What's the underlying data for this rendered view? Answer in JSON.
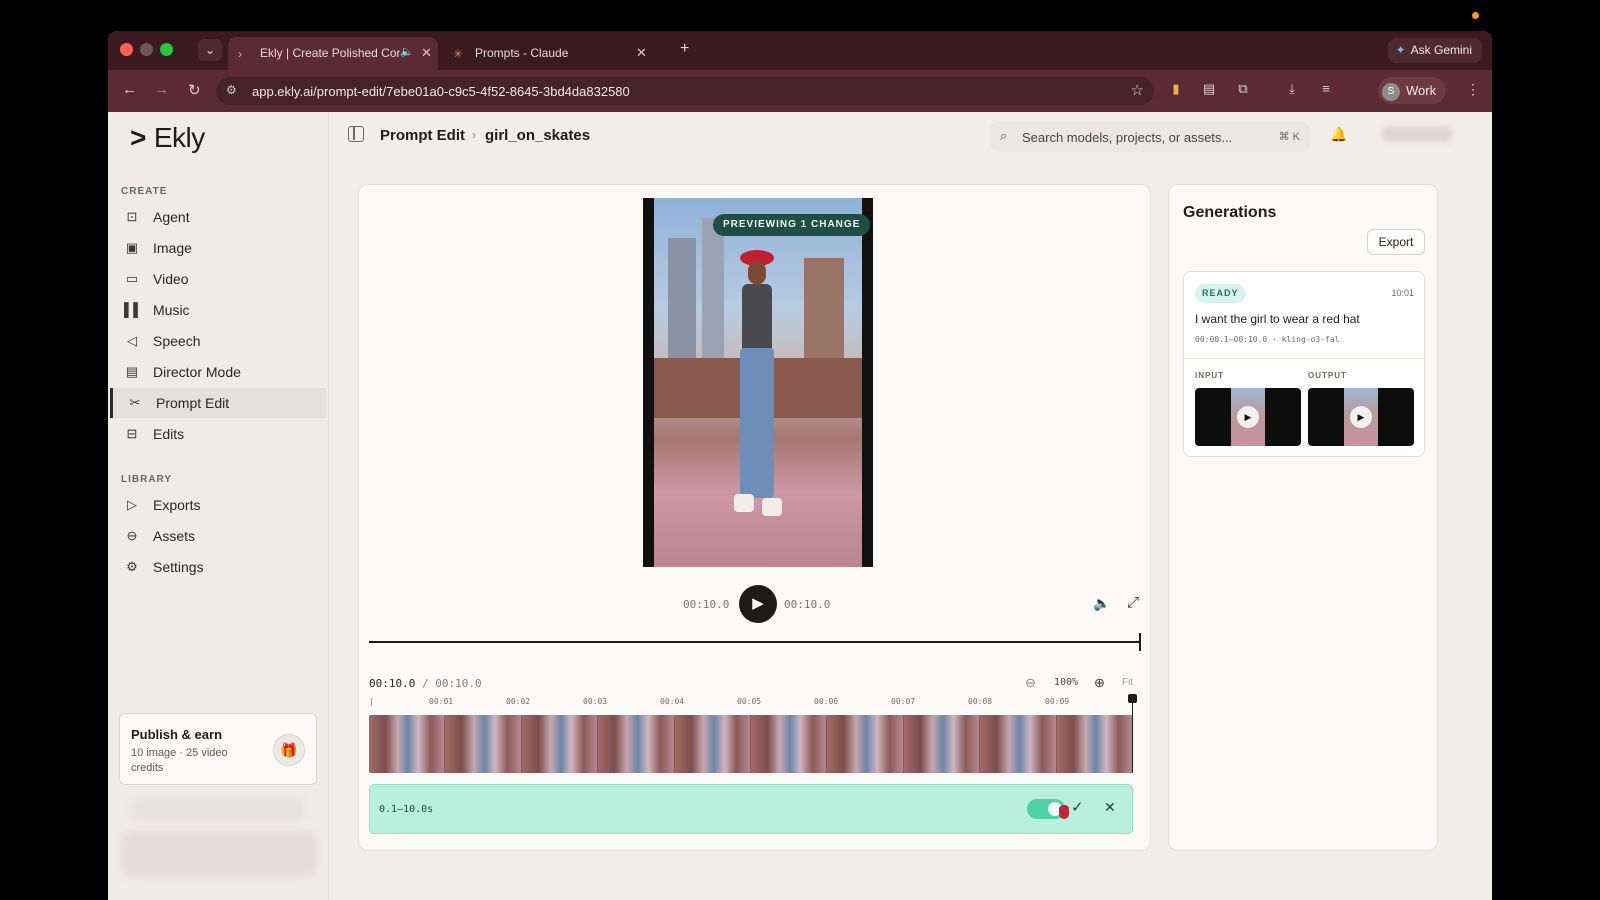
{
  "browser": {
    "tabs": [
      {
        "title": "Ekly | Create Polished Con",
        "active": true
      },
      {
        "title": "Prompts - Claude",
        "active": false
      }
    ],
    "url": "app.ekly.ai/prompt-edit/7ebe01a0-c9c5-4f52-8645-3bd4da832580",
    "ask_gemini": "Ask Gemini",
    "profile": {
      "initial": "S",
      "name": "Work"
    }
  },
  "app": {
    "logo": "Ekly",
    "sidebar": {
      "create_label": "CREATE",
      "create_items": [
        {
          "label": "Agent",
          "icon": "robot-icon"
        },
        {
          "label": "Image",
          "icon": "image-icon"
        },
        {
          "label": "Video",
          "icon": "video-icon"
        },
        {
          "label": "Music",
          "icon": "music-icon"
        },
        {
          "label": "Speech",
          "icon": "speech-icon"
        },
        {
          "label": "Director Mode",
          "icon": "clapper-icon"
        },
        {
          "label": "Prompt Edit",
          "icon": "scissors-icon",
          "active": true
        },
        {
          "label": "Edits",
          "icon": "edits-icon"
        }
      ],
      "library_label": "LIBRARY",
      "library_items": [
        {
          "label": "Exports",
          "icon": "play-outline-icon"
        },
        {
          "label": "Assets",
          "icon": "archive-icon"
        },
        {
          "label": "Settings",
          "icon": "gear-icon"
        }
      ],
      "publish": {
        "title": "Publish & earn",
        "subtitle": "10 image · 25 video credits"
      }
    },
    "header": {
      "breadcrumb": [
        "Prompt Edit",
        "girl_on_skates"
      ],
      "search_placeholder": "Search models, projects, or assets...",
      "search_shortcut": "⌘ K"
    },
    "editor": {
      "preview_badge": "PREVIEWING 1 CHANGE",
      "time_current": "00:10.0",
      "time_end": "00:10.0",
      "timeline_time": "00:10.0",
      "timeline_total": "/ 00:10.0",
      "zoom": "100%",
      "fit_label": "Fit",
      "ruler_ticks": [
        "00:01",
        "00:02",
        "00:03",
        "00:04",
        "00:05",
        "00:06",
        "00:07",
        "00:08",
        "00:09"
      ],
      "clip_range": "0.1–10.0s",
      "clip_enabled": true,
      "playback_progress": 1.0
    },
    "generations": {
      "title": "Generations",
      "export_label": "Export",
      "items": [
        {
          "status": "READY",
          "time": "10:01",
          "prompt": "I want the girl to wear a red hat",
          "meta": "00:00.1–00:10.0  ·  kling-o3-fal",
          "input_label": "INPUT",
          "output_label": "OUTPUT"
        }
      ]
    }
  },
  "colors": {
    "accent_mint": "#b9efdd",
    "badge_green": "#1f4f44",
    "browser_maroon": "#5a2b33"
  }
}
